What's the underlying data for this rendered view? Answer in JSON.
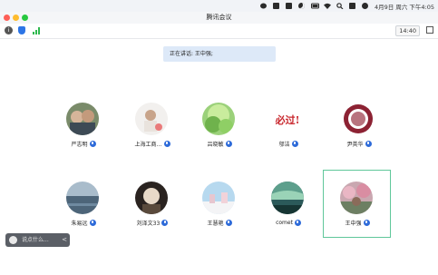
{
  "menubar": {
    "datetime": "4月9日 周六 下午4:05"
  },
  "window": {
    "title": "腾讯会议"
  },
  "toolbar": {
    "meeting_time": "14:40"
  },
  "speaking": {
    "text": "正在讲话: 王中强;"
  },
  "participants": [
    {
      "name": "严志明"
    },
    {
      "name": "上海工商…"
    },
    {
      "name": "吕晓敏"
    },
    {
      "name": "邬洁",
      "logo_text": "必过!"
    },
    {
      "name": "尹英华"
    },
    {
      "name": "朱易远"
    },
    {
      "name": "刘泽文33"
    },
    {
      "name": "王慧艳"
    },
    {
      "name": "comet"
    },
    {
      "name": "王中强"
    }
  ],
  "chat": {
    "placeholder": "说点什么...",
    "arrow": "<"
  },
  "colors": {
    "highlight_border": "#5fc79a",
    "mic_badge": "#2e6bd9",
    "speaking_bg": "#dde9f8"
  }
}
